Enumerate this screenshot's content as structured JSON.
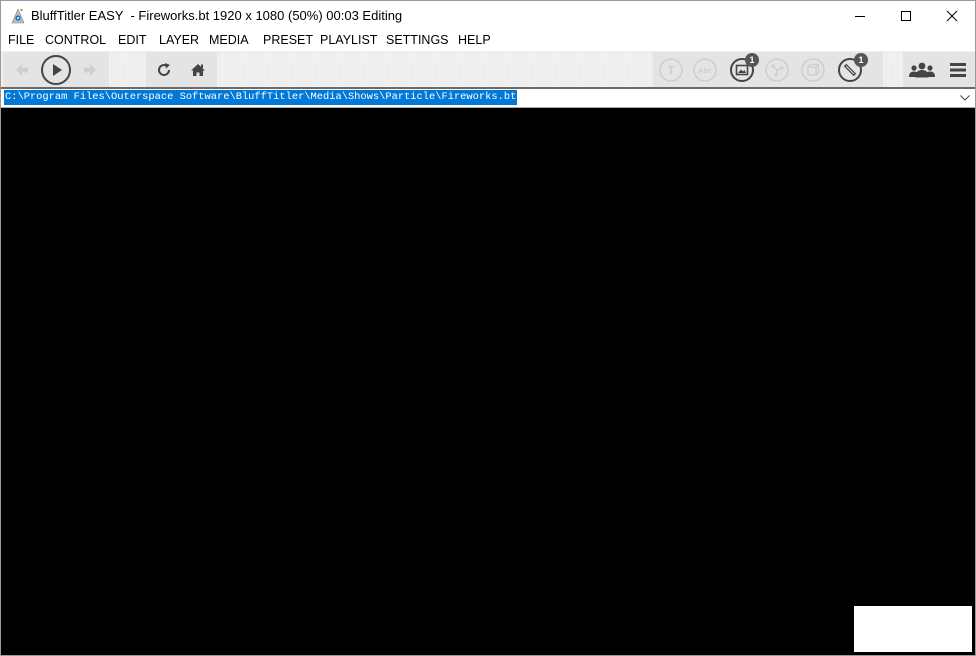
{
  "window": {
    "app_name": "BluffTitler EASY",
    "title": "BluffTitler EASY  - Fireworks.bt 1920 x 1080 (50%) 00:03 Editing",
    "controls": [
      "minimize",
      "maximize",
      "close"
    ]
  },
  "menu": {
    "items": [
      "FILE",
      "CONTROL",
      "EDIT",
      "LAYER",
      "MEDIA",
      "PRESET",
      "PLAYLIST",
      "SETTINGS",
      "HELP"
    ]
  },
  "toolbar": {
    "playback": [
      {
        "icon": "back-arrow-icon",
        "enabled": false
      },
      {
        "icon": "play-icon",
        "enabled": true
      },
      {
        "icon": "forward-arrow-icon",
        "enabled": false
      }
    ],
    "actions": [
      {
        "icon": "reload-icon",
        "enabled": true
      },
      {
        "icon": "home-icon",
        "enabled": true
      }
    ],
    "layers": [
      {
        "icon": "text-layer-icon",
        "glyph": "T",
        "enabled": false
      },
      {
        "icon": "abc-layer-icon",
        "glyph": "Abc",
        "enabled": false
      },
      {
        "icon": "picture-layer-icon",
        "enabled": true,
        "badge": "1"
      },
      {
        "icon": "particle-layer-icon",
        "enabled": false
      },
      {
        "icon": "model-layer-icon",
        "enabled": false
      },
      {
        "icon": "camera-layer-icon",
        "enabled": true,
        "badge": "1"
      }
    ],
    "right": [
      {
        "icon": "people-icon"
      },
      {
        "icon": "hamburger-menu-icon"
      }
    ]
  },
  "pathbar": {
    "value": "C:\\Program Files\\Outerspace Software\\BluffTitler\\Media\\Shows\\Particle\\Fireworks.bt"
  },
  "colors": {
    "selection": "#0078d7",
    "canvas": "#000000",
    "toolbar_bg": "#f0f0f0",
    "icon_active": "#444444",
    "icon_disabled": "#cfcfcf"
  }
}
